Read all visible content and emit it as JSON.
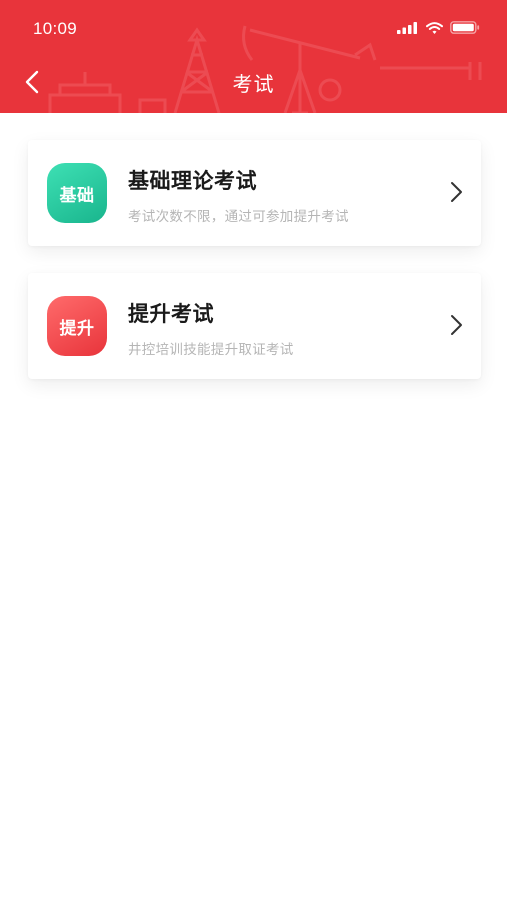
{
  "status_bar": {
    "time": "10:09",
    "icons": [
      "signal-icon",
      "wifi-icon",
      "battery-icon"
    ]
  },
  "nav": {
    "title": "考试",
    "back_icon": "chevron-left-icon"
  },
  "colors": {
    "header": "#e8343b",
    "card_icon_green": "#19b58d",
    "card_icon_red": "#e8343b",
    "subtitle": "#b5b5b5"
  },
  "cards": [
    {
      "icon_label": "基础",
      "title": "基础理论考试",
      "subtitle": "考试次数不限，通过可参加提升考试",
      "icon_color": "green"
    },
    {
      "icon_label": "提升",
      "title": "提升考试",
      "subtitle": "井控培训技能提升取证考试",
      "icon_color": "red"
    }
  ]
}
